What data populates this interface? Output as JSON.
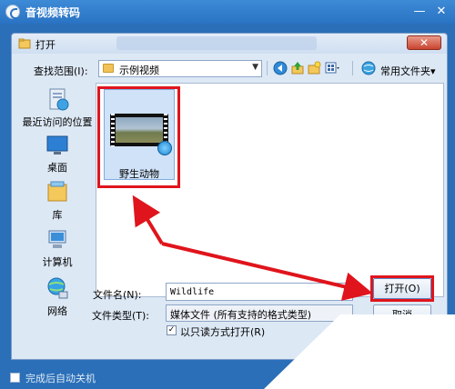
{
  "app": {
    "title": "音视频转码",
    "minimize": "—",
    "close": "✕",
    "auto_shutdown_label": "完成后自动关机"
  },
  "dialog": {
    "title": "打开",
    "close": "✕",
    "lookin_label": "查找范围(I):",
    "lookin_value": "示例视频",
    "favorites_label": "常用文件夹▾",
    "sidebar": [
      {
        "label": "最近访问的位置",
        "icon": "recent-places-icon"
      },
      {
        "label": "桌面",
        "icon": "desktop-icon"
      },
      {
        "label": "库",
        "icon": "library-icon"
      },
      {
        "label": "计算机",
        "icon": "computer-icon"
      },
      {
        "label": "网络",
        "icon": "network-icon"
      }
    ],
    "file": {
      "label": "野生动物",
      "icon": "video-file-icon"
    },
    "filename_label": "文件名(N):",
    "filename_value": "Wildlife",
    "filetype_label": "文件类型(T):",
    "filetype_value": "媒体文件 (所有支持的格式类型)",
    "readonly_label": "以只读方式打开(R)",
    "readonly_checked": "✓",
    "open_button": "打开(O)",
    "cancel_button": "取消"
  },
  "colors": {
    "highlight": "#e0141c",
    "app_blue": "#2a6fb8"
  }
}
